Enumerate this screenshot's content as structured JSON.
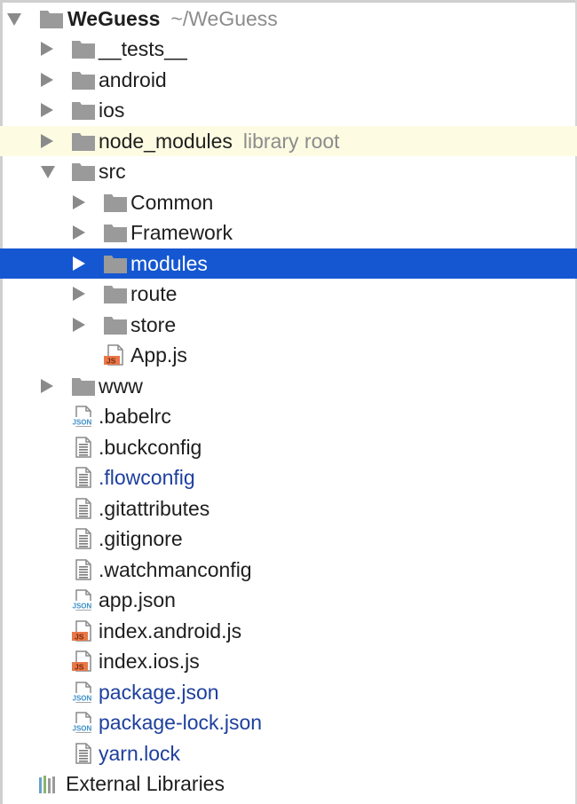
{
  "root": {
    "name": "WeGuess",
    "path": "~/WeGuess"
  },
  "tree": [
    {
      "label": "__tests__",
      "kind": "folder",
      "arrow": "right",
      "indent": 1
    },
    {
      "label": "android",
      "kind": "folder",
      "arrow": "right",
      "indent": 1
    },
    {
      "label": "ios",
      "kind": "folder",
      "arrow": "right",
      "indent": 1
    },
    {
      "label": "node_modules",
      "suffix": "library root",
      "kind": "folder",
      "arrow": "right",
      "indent": 1,
      "highlight": true
    },
    {
      "label": "src",
      "kind": "folder",
      "arrow": "down",
      "indent": 1
    },
    {
      "label": "Common",
      "kind": "folder",
      "arrow": "right",
      "indent": 2
    },
    {
      "label": "Framework",
      "kind": "folder",
      "arrow": "right",
      "indent": 2
    },
    {
      "label": "modules",
      "kind": "folder",
      "arrow": "right",
      "indent": 2,
      "selected": true
    },
    {
      "label": "route",
      "kind": "folder",
      "arrow": "right",
      "indent": 2
    },
    {
      "label": "store",
      "kind": "folder",
      "arrow": "right",
      "indent": 2
    },
    {
      "label": "App.js",
      "kind": "js",
      "indent": 2
    },
    {
      "label": "www",
      "kind": "folder",
      "arrow": "right",
      "indent": 1
    },
    {
      "label": ".babelrc",
      "kind": "json",
      "indent": 1
    },
    {
      "label": ".buckconfig",
      "kind": "text",
      "indent": 1
    },
    {
      "label": ".flowconfig",
      "kind": "text",
      "indent": 1,
      "modified": true
    },
    {
      "label": ".gitattributes",
      "kind": "text",
      "indent": 1
    },
    {
      "label": ".gitignore",
      "kind": "text",
      "indent": 1
    },
    {
      "label": ".watchmanconfig",
      "kind": "text",
      "indent": 1
    },
    {
      "label": "app.json",
      "kind": "json",
      "indent": 1
    },
    {
      "label": "index.android.js",
      "kind": "js",
      "indent": 1
    },
    {
      "label": "index.ios.js",
      "kind": "js",
      "indent": 1
    },
    {
      "label": "package.json",
      "kind": "json",
      "indent": 1,
      "modified": true
    },
    {
      "label": "package-lock.json",
      "kind": "json",
      "indent": 1,
      "modified": true
    },
    {
      "label": "yarn.lock",
      "kind": "text",
      "indent": 1,
      "modified": true
    }
  ],
  "external": {
    "label": "External Libraries",
    "icon": "library-bars-icon"
  },
  "icons": {
    "folder": "folder-icon",
    "js": "js-file-icon",
    "json": "json-file-icon",
    "text": "text-file-icon",
    "js_badge": "JS",
    "json_badge": "JSON"
  },
  "colors": {
    "selection": "#1557d1",
    "library_highlight": "#fdfbe2",
    "modified_text": "#1d3f9e",
    "folder": "#9a9a9a",
    "js_badge": "#e8784a",
    "json_badge": "#3d8fc7"
  }
}
